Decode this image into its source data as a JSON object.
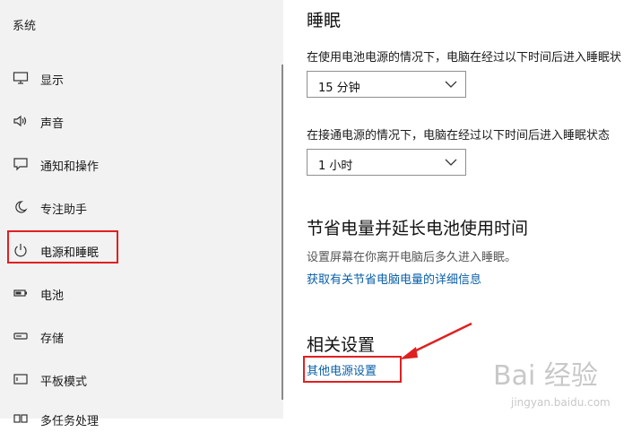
{
  "sidebar": {
    "title": "系统",
    "items": [
      {
        "label": "显示",
        "icon": "monitor-icon"
      },
      {
        "label": "声音",
        "icon": "speaker-icon"
      },
      {
        "label": "通知和操作",
        "icon": "notification-icon"
      },
      {
        "label": "专注助手",
        "icon": "moon-icon"
      },
      {
        "label": "电源和睡眠",
        "icon": "power-icon",
        "active": true
      },
      {
        "label": "电池",
        "icon": "battery-icon"
      },
      {
        "label": "存储",
        "icon": "storage-icon"
      },
      {
        "label": "平板模式",
        "icon": "tablet-icon"
      },
      {
        "label": "多任务处理",
        "icon": "multitask-icon"
      }
    ]
  },
  "sleep": {
    "heading": "睡眠",
    "battery_desc": "在使用电池电源的情况下，电脑在经过以下时间后进入睡眠状",
    "battery_value": "15 分钟",
    "plugged_desc": "在接通电源的情况下，电脑在经过以下时间后进入睡眠状态",
    "plugged_value": "1 小时"
  },
  "save_power": {
    "heading": "节省电量并延长电池使用时间",
    "desc": "设置屏幕在你离开电脑后多久进入睡眠。",
    "link": "获取有关节省电脑电量的详细信息"
  },
  "related": {
    "heading": "相关设置",
    "link": "其他电源设置"
  },
  "watermark": {
    "text": "Bai 经验",
    "sub": "jingyan.baidu.com"
  },
  "colors": {
    "accent_link": "#0a5fa8",
    "highlight": "#e02020",
    "sidebar_bg": "#f2f2f2"
  }
}
